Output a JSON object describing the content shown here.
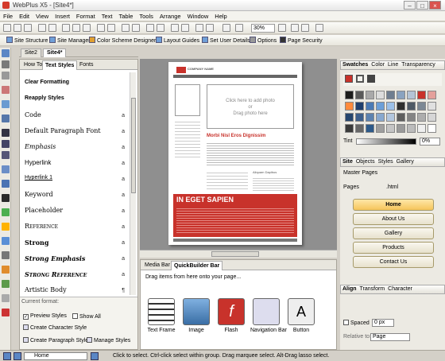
{
  "window": {
    "title": "WebPlus X5 - [Site4*]"
  },
  "menu": [
    "File",
    "Edit",
    "View",
    "Insert",
    "Format",
    "Text",
    "Table",
    "Tools",
    "Arrange",
    "Window",
    "Help"
  ],
  "toolbar": {
    "zoom": "30%"
  },
  "toolbar2": {
    "site_structure": "Site Structure",
    "site_manager": "Site Manager",
    "color_scheme_designer": "Color Scheme Designer",
    "layout_guides": "Layout Guides",
    "set_user_details": "Set User Details",
    "options": "Options",
    "page_security": "Page Security"
  },
  "doc_tabs": [
    "Site2",
    "Site4*"
  ],
  "left_panel": {
    "tabs": [
      "How To",
      "Text Styles",
      "Fonts"
    ],
    "styles": [
      "Clear Formatting",
      "Reapply Styles",
      "Code",
      "Default Paragraph Font",
      "Emphasis",
      "Hyperlink",
      "Hyperlink 1",
      "Keyword",
      "Placeholder",
      "Reference",
      "Strong",
      "Strong Emphasis",
      "Strong Reference",
      "Artistic Body"
    ],
    "current_format_label": "Current format:",
    "preview_styles": "Preview Styles",
    "show_all": "Show All",
    "create_character_style": "Create Character Style",
    "create_paragraph_style": "Create Paragraph Style",
    "manage_styles": "Manage Styles"
  },
  "canvas": {
    "company_name": "COMPANY NAME",
    "photo_placeholder_1": "Click here to add photo",
    "photo_placeholder_2": "or",
    "photo_placeholder_3": "Drag photo here",
    "heading": "Morbi Nisl Eros Dignissim",
    "sub_heading": "Aliquam Dapibus",
    "banner": "IN EGET SAPIEN"
  },
  "bottom_panel": {
    "tabs": [
      "Media Bar",
      "QuickBuilder Bar"
    ],
    "hint": "Drag items from here onto your page...",
    "items": [
      "Text Frame",
      "Image",
      "Flash",
      "Navigation Bar",
      "Button"
    ]
  },
  "right_panel": {
    "swatch_tabs": [
      "Swatches",
      "Color",
      "Line",
      "Transparency"
    ],
    "tint_label": "Tint",
    "tint_value": "0%",
    "site_tabs": [
      "Site",
      "Objects",
      "Styles",
      "Gallery"
    ],
    "master_pages": "Master Pages",
    "pages_label": "Pages",
    "html_label": ".html",
    "pages": [
      "Home",
      "About Us",
      "Gallery",
      "Products",
      "Contact Us"
    ],
    "align_tabs": [
      "Align",
      "Transform",
      "Character"
    ],
    "spaced_label": "Spaced",
    "spaced_value": "0 px",
    "relative_to_label": "Relative to:",
    "relative_to_value": "Page"
  },
  "status": {
    "page_combo": "Home",
    "message": "Click to select. Ctrl-click select within group. Drag marquee select. Alt-Drag lasso select."
  },
  "colors": {
    "accent_red": "#c8322b",
    "page_button_sel": "#f5c45a",
    "window_bg": "#d4d0c8"
  }
}
